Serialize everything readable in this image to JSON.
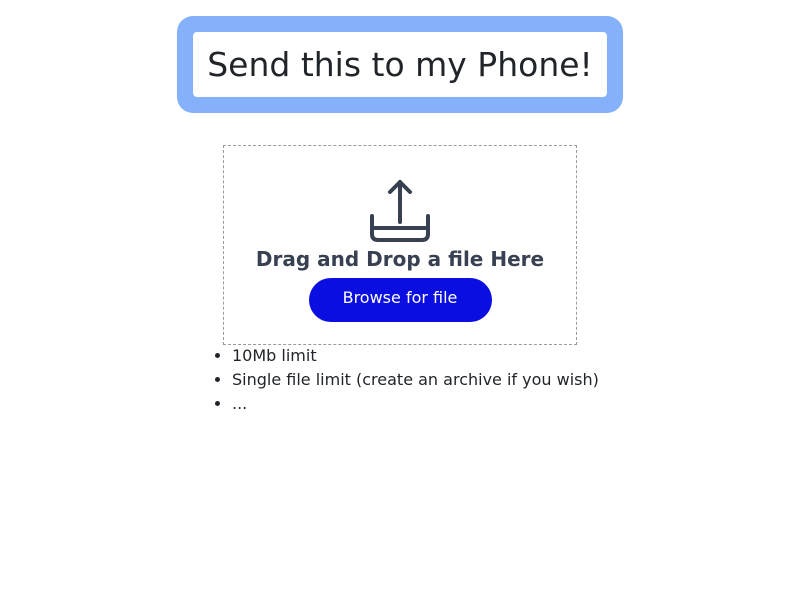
{
  "header": {
    "title": "Send this to my Phone!"
  },
  "upload": {
    "icon": "upload-tray-icon",
    "heading": "Drag and Drop a file Here",
    "browse_label": "Browse for file"
  },
  "limits": [
    "10Mb limit",
    "Single file limit (create an archive if you wish)",
    "..."
  ],
  "colors": {
    "title_frame": "#84b1fa",
    "button": "#0b0ee0",
    "icon": "#374151"
  }
}
